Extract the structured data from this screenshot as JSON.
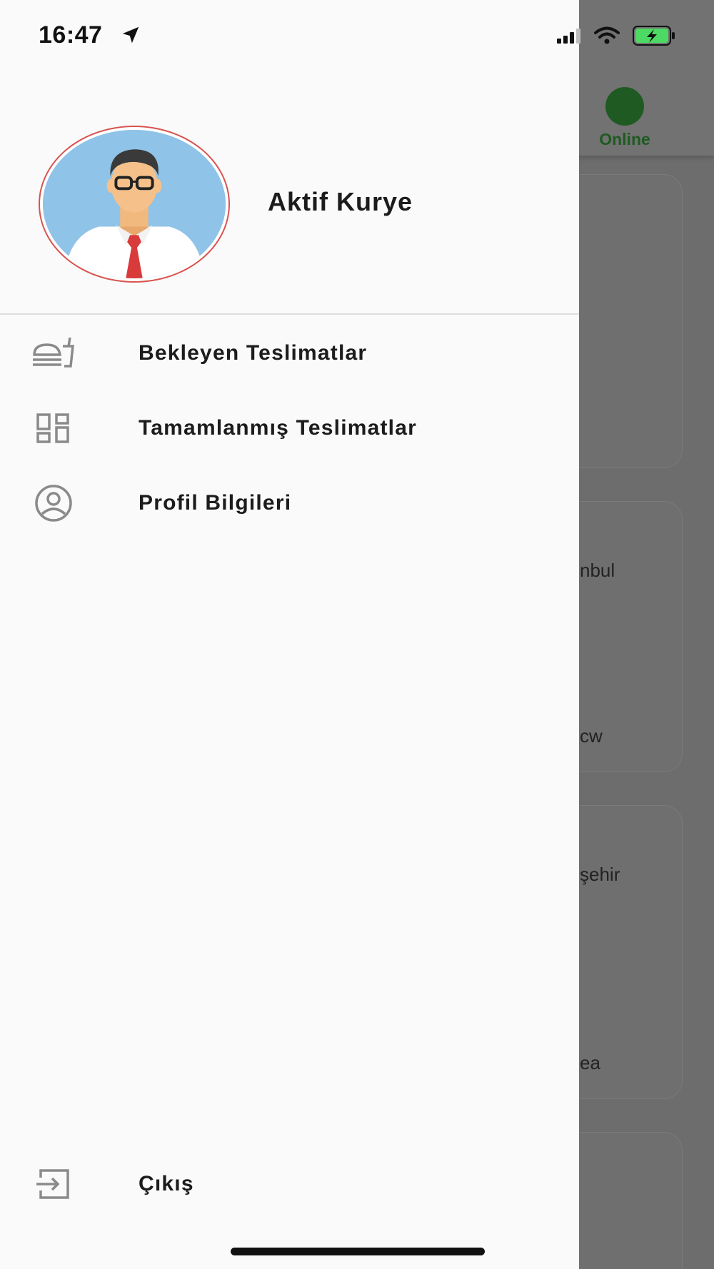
{
  "status_bar": {
    "time": "16:47",
    "location_icon": "location-arrow-icon",
    "signal_icon": "cellular-signal-icon",
    "wifi_icon": "wifi-icon",
    "battery_icon": "battery-charging-icon"
  },
  "background": {
    "online_label": "Online",
    "online_color": "#1f5a22",
    "card_fragments": [
      "nbul",
      "cw",
      "şehir",
      "ea"
    ]
  },
  "drawer": {
    "user_name": "Aktif Kurye",
    "menu": [
      {
        "label": "Bekleyen Teslimatlar",
        "icon": "fastfood-icon"
      },
      {
        "label": "Tamamlanmış Teslimatlar",
        "icon": "dashboard-icon"
      },
      {
        "label": "Profil Bilgileri",
        "icon": "account-circle-icon"
      }
    ],
    "logout": {
      "label": "Çıkış",
      "icon": "exit-icon"
    }
  },
  "colors": {
    "drawer_bg": "#fafafa",
    "avatar_border": "#d9534f",
    "icon_gray": "#8a8a8a",
    "battery_green": "#4cd964"
  }
}
